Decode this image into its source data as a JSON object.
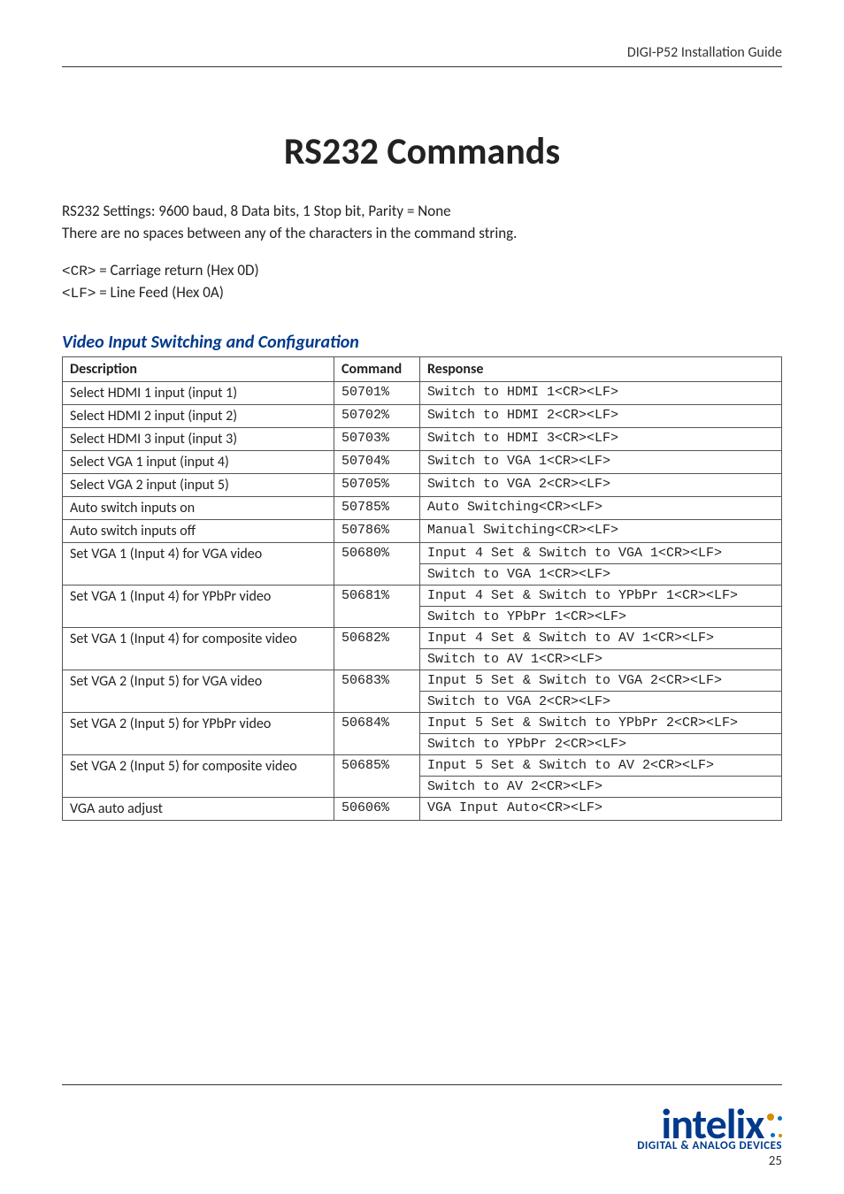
{
  "header": {
    "doc_title": "DIGI-P52 Installation Guide"
  },
  "title": "RS232 Commands",
  "intro": {
    "line1": "RS232 Settings: 9600 baud, 8 Data bits, 1 Stop bit, Parity = None",
    "line2": "There are no spaces between any of the characters in the command string."
  },
  "legend": {
    "cr_code": "<CR>",
    "cr_text": " = Carriage return (Hex 0D)",
    "lf_code": "<LF>",
    "lf_text": " = Line Feed (Hex 0A)"
  },
  "section_title": "Video Input Switching and Configuration",
  "table": {
    "headers": {
      "c1": "Description",
      "c2": "Command",
      "c3": "Response"
    },
    "rows": [
      {
        "desc": "Select HDMI 1 input (input 1)",
        "cmd": "50701%",
        "resp": "Switch to HDMI 1<CR><LF>",
        "span": 1
      },
      {
        "desc": "Select HDMI 2 input (input 2)",
        "cmd": "50702%",
        "resp": "Switch to HDMI 2<CR><LF>",
        "span": 1
      },
      {
        "desc": "Select HDMI 3 input (input 3)",
        "cmd": "50703%",
        "resp": "Switch to HDMI 3<CR><LF>",
        "span": 1
      },
      {
        "desc": "Select VGA 1 input (input 4)",
        "cmd": "50704%",
        "resp": "Switch to VGA 1<CR><LF>",
        "span": 1
      },
      {
        "desc": "Select VGA 2 input (input 5)",
        "cmd": "50705%",
        "resp": "Switch to VGA 2<CR><LF>",
        "span": 1
      },
      {
        "desc": "Auto switch inputs on",
        "cmd": "50785%",
        "resp": "Auto Switching<CR><LF>",
        "span": 1
      },
      {
        "desc": "Auto switch inputs off",
        "cmd": "50786%",
        "resp": "Manual Switching<CR><LF>",
        "span": 1
      },
      {
        "desc": "Set VGA 1 (Input 4) for VGA video",
        "cmd": "50680%",
        "resp": "Input 4 Set & Switch to VGA 1<CR><LF>",
        "resp2": "Switch to VGA 1<CR><LF>",
        "span": 2
      },
      {
        "desc": "Set VGA 1 (Input 4) for YPbPr video",
        "cmd": "50681%",
        "resp": "Input 4 Set & Switch to YPbPr 1<CR><LF>",
        "resp2": "Switch to YPbPr 1<CR><LF>",
        "span": 2
      },
      {
        "desc": "Set VGA 1 (Input 4) for composite video",
        "cmd": "50682%",
        "resp": "Input 4 Set & Switch to AV 1<CR><LF>",
        "resp2": "Switch to AV 1<CR><LF>",
        "span": 2
      },
      {
        "desc": "Set VGA 2 (Input 5) for VGA video",
        "cmd": "50683%",
        "resp": "Input 5 Set & Switch to VGA 2<CR><LF>",
        "resp2": "Switch to VGA 2<CR><LF>",
        "span": 2
      },
      {
        "desc": "Set VGA 2 (Input 5) for YPbPr video",
        "cmd": "50684%",
        "resp": "Input 5 Set & Switch to YPbPr 2<CR><LF>",
        "resp2": "Switch to YPbPr 2<CR><LF>",
        "span": 2
      },
      {
        "desc": "Set VGA 2 (Input 5) for composite video",
        "cmd": "50685%",
        "resp": "Input 5 Set & Switch to AV 2<CR><LF>",
        "resp2": "Switch to AV 2<CR><LF>",
        "span": 2
      },
      {
        "desc": "VGA auto adjust",
        "cmd": "50606%",
        "resp": "VGA Input Auto<CR><LF>",
        "span": 1
      }
    ]
  },
  "footer": {
    "logo_text": "intelix",
    "logo_sub": "DIGITAL & ANALOG DEVICES",
    "page_num": "25"
  }
}
